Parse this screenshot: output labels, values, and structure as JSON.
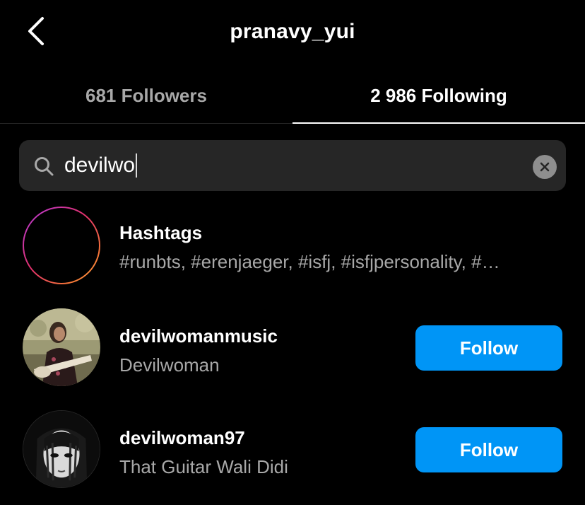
{
  "header": {
    "title": "pranavy_yui",
    "back_icon": "chevron-left-icon"
  },
  "tabs": [
    {
      "label": "681 Followers",
      "active": false
    },
    {
      "label": "2 986 Following",
      "active": true
    }
  ],
  "search": {
    "value": "devilwo",
    "icon": "search-icon",
    "clear_icon": "clear-icon"
  },
  "results": {
    "hashtags": {
      "title": "Hashtags",
      "subtitle": "#runbts, #erenjaeger, #isfj, #isfjpersonality, #…",
      "icon": "hashtag-icon"
    },
    "users": [
      {
        "username": "devilwomanmusic",
        "full_name": "Devilwoman",
        "button_label": "Follow"
      },
      {
        "username": "devilwoman97",
        "full_name": "That Guitar Wali Didi",
        "button_label": "Follow"
      }
    ]
  },
  "colors": {
    "background": "#000000",
    "accent": "#0095f6",
    "secondary_text": "#a8a8a8",
    "search_bg": "#262626"
  }
}
